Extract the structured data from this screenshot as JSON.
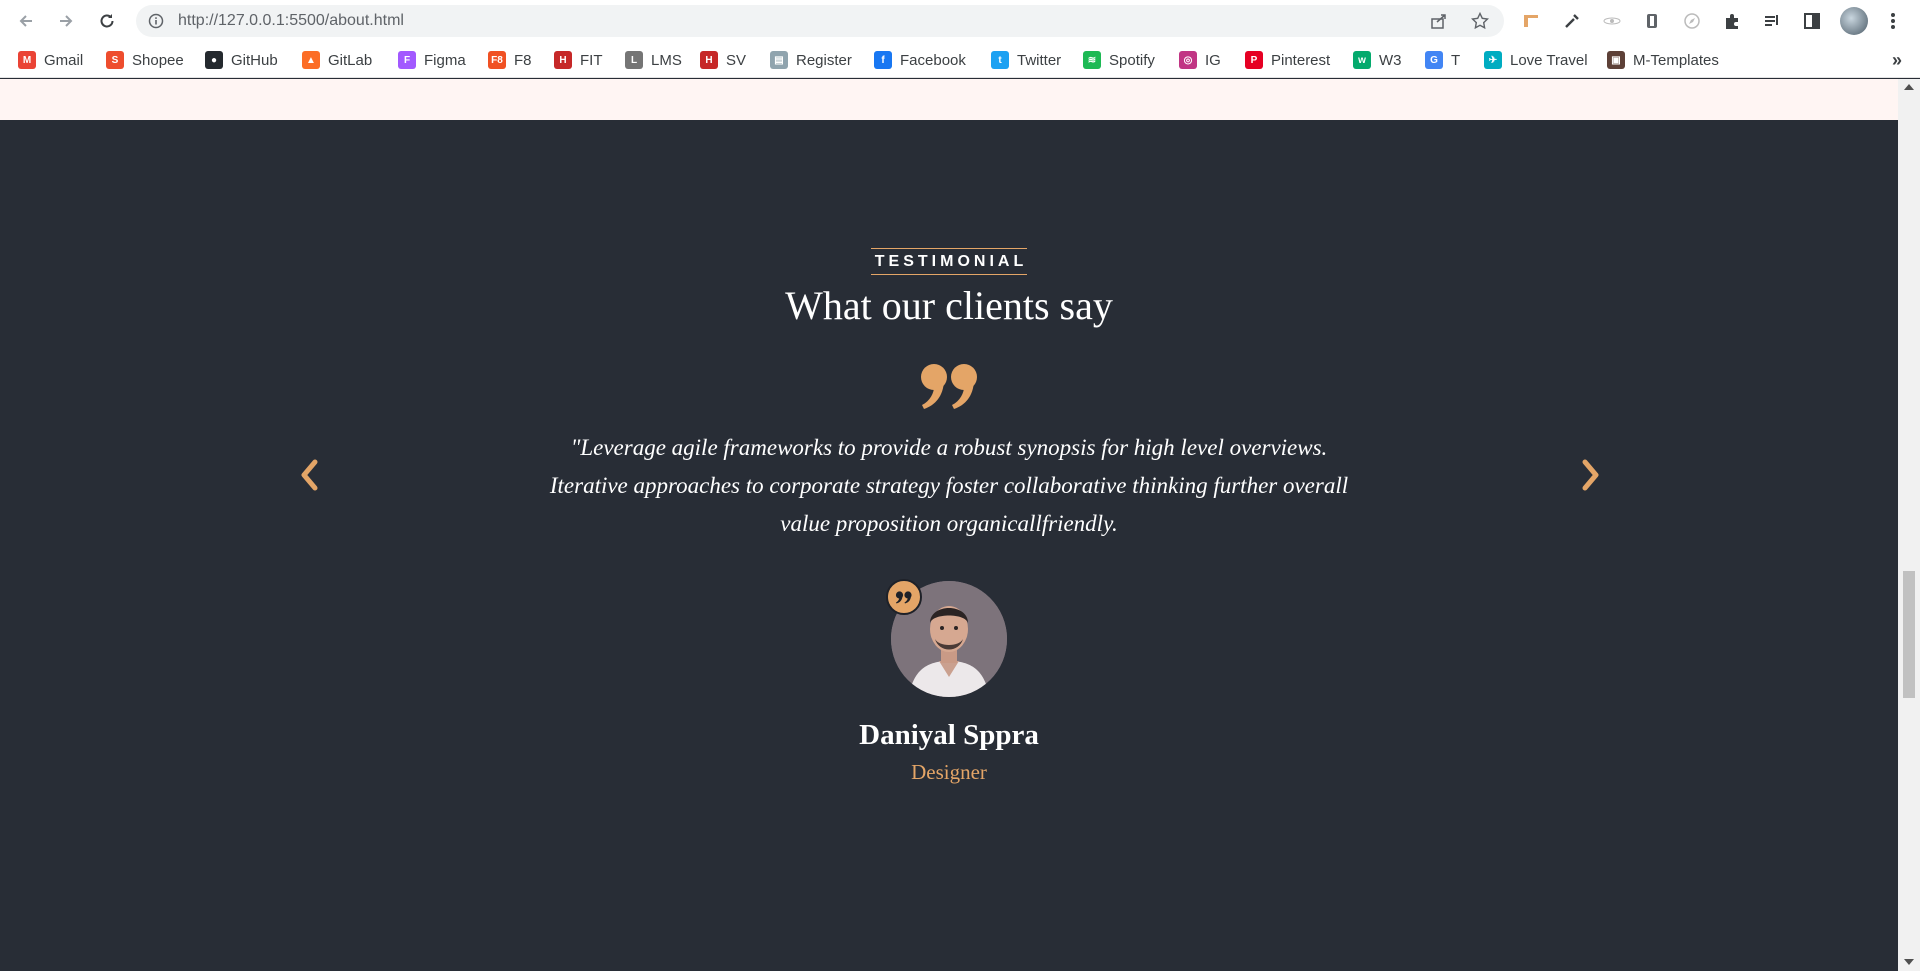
{
  "browser": {
    "url": "http://127.0.0.1:5500/about.html",
    "bookmarks": [
      {
        "label": "Gmail",
        "icon": "gmail-icon",
        "color": "#ea4335",
        "glyph": "M"
      },
      {
        "label": "Shopee",
        "icon": "shopee-icon",
        "color": "#ee4d2d",
        "glyph": "S"
      },
      {
        "label": "GitHub",
        "icon": "github-icon",
        "color": "#24292e",
        "glyph": "●"
      },
      {
        "label": "GitLab",
        "icon": "gitlab-icon",
        "color": "#fc6d26",
        "glyph": "▲"
      },
      {
        "label": "Figma",
        "icon": "figma-icon",
        "color": "#a259ff",
        "glyph": "F"
      },
      {
        "label": "F8",
        "icon": "f8-icon",
        "color": "#f05123",
        "glyph": "F8"
      },
      {
        "label": "FIT",
        "icon": "fit-icon",
        "color": "#c62828",
        "glyph": "H"
      },
      {
        "label": "LMS",
        "icon": "lms-icon",
        "color": "#757575",
        "glyph": "L"
      },
      {
        "label": "SV",
        "icon": "sv-icon",
        "color": "#c62828",
        "glyph": "H"
      },
      {
        "label": "Register",
        "icon": "register-icon",
        "color": "#90a4ae",
        "glyph": "▤"
      },
      {
        "label": "Facebook",
        "icon": "facebook-icon",
        "color": "#1877f2",
        "glyph": "f"
      },
      {
        "label": "Twitter",
        "icon": "twitter-icon",
        "color": "#1da1f2",
        "glyph": "t"
      },
      {
        "label": "Spotify",
        "icon": "spotify-icon",
        "color": "#1db954",
        "glyph": "≋"
      },
      {
        "label": "IG",
        "icon": "instagram-icon",
        "color": "#c13584",
        "glyph": "◎"
      },
      {
        "label": "Pinterest",
        "icon": "pinterest-icon",
        "color": "#e60023",
        "glyph": "P"
      },
      {
        "label": "W3",
        "icon": "w3-icon",
        "color": "#04aa6d",
        "glyph": "w"
      },
      {
        "label": "T",
        "icon": "translate-icon",
        "color": "#4285f4",
        "glyph": "G"
      },
      {
        "label": "Love Travel",
        "icon": "travel-icon",
        "color": "#00acc1",
        "glyph": "✈"
      },
      {
        "label": "M-Templates",
        "icon": "templates-icon",
        "color": "#5d4037",
        "glyph": "▣"
      }
    ]
  },
  "testimonial": {
    "eyebrow": "TESTIMONIAL",
    "title": "What our clients say",
    "quote": "\"Leverage agile frameworks to provide a robust synopsis for high level overviews. Iterative approaches to corporate strategy foster collaborative thinking further overall value proposition organicallfriendly.",
    "name": "Daniyal Sppra",
    "role": "Designer",
    "accent": "#e4a567",
    "background": "#282d36"
  }
}
